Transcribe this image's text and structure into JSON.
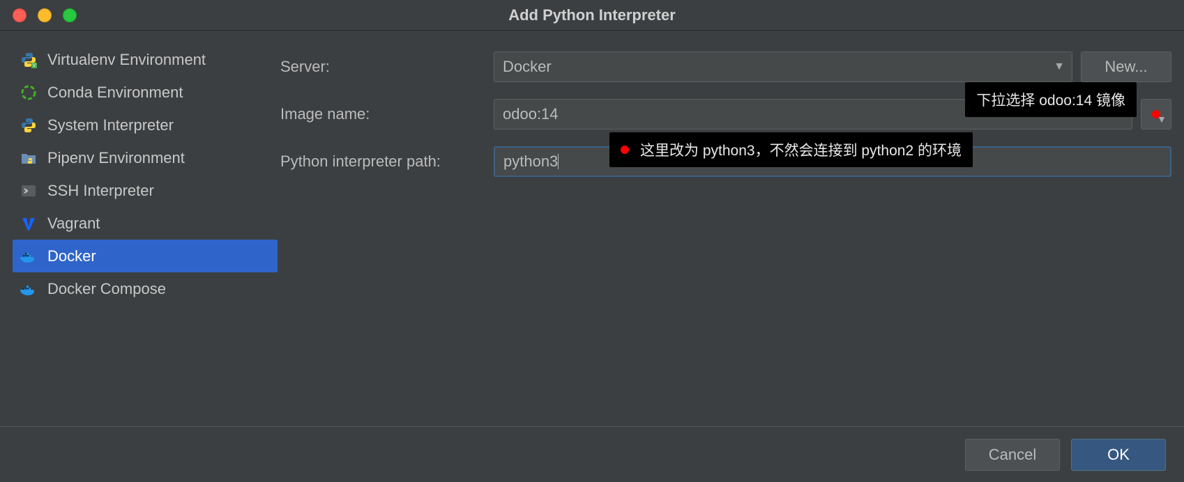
{
  "dialog": {
    "title": "Add Python Interpreter"
  },
  "sidebar": {
    "items": [
      {
        "label": "Virtualenv Environment",
        "icon": "python-badge"
      },
      {
        "label": "Conda Environment",
        "icon": "conda-ring"
      },
      {
        "label": "System Interpreter",
        "icon": "python-logo"
      },
      {
        "label": "Pipenv Environment",
        "icon": "folder-python"
      },
      {
        "label": "SSH Interpreter",
        "icon": "ssh-arrow"
      },
      {
        "label": "Vagrant",
        "icon": "vagrant-v"
      },
      {
        "label": "Docker",
        "icon": "docker-whale"
      },
      {
        "label": "Docker Compose",
        "icon": "docker-whale"
      }
    ],
    "selected_index": 6
  },
  "form": {
    "server_label": "Server:",
    "server_value": "Docker",
    "new_button": "New...",
    "image_label": "Image name:",
    "image_value": "odoo:14",
    "path_label": "Python interpreter path:",
    "path_value": "python3"
  },
  "tooltips": {
    "image": "下拉选择 odoo:14 镜像",
    "path": "这里改为 python3，不然会连接到 python2 的环境"
  },
  "footer": {
    "cancel": "Cancel",
    "ok": "OK"
  }
}
